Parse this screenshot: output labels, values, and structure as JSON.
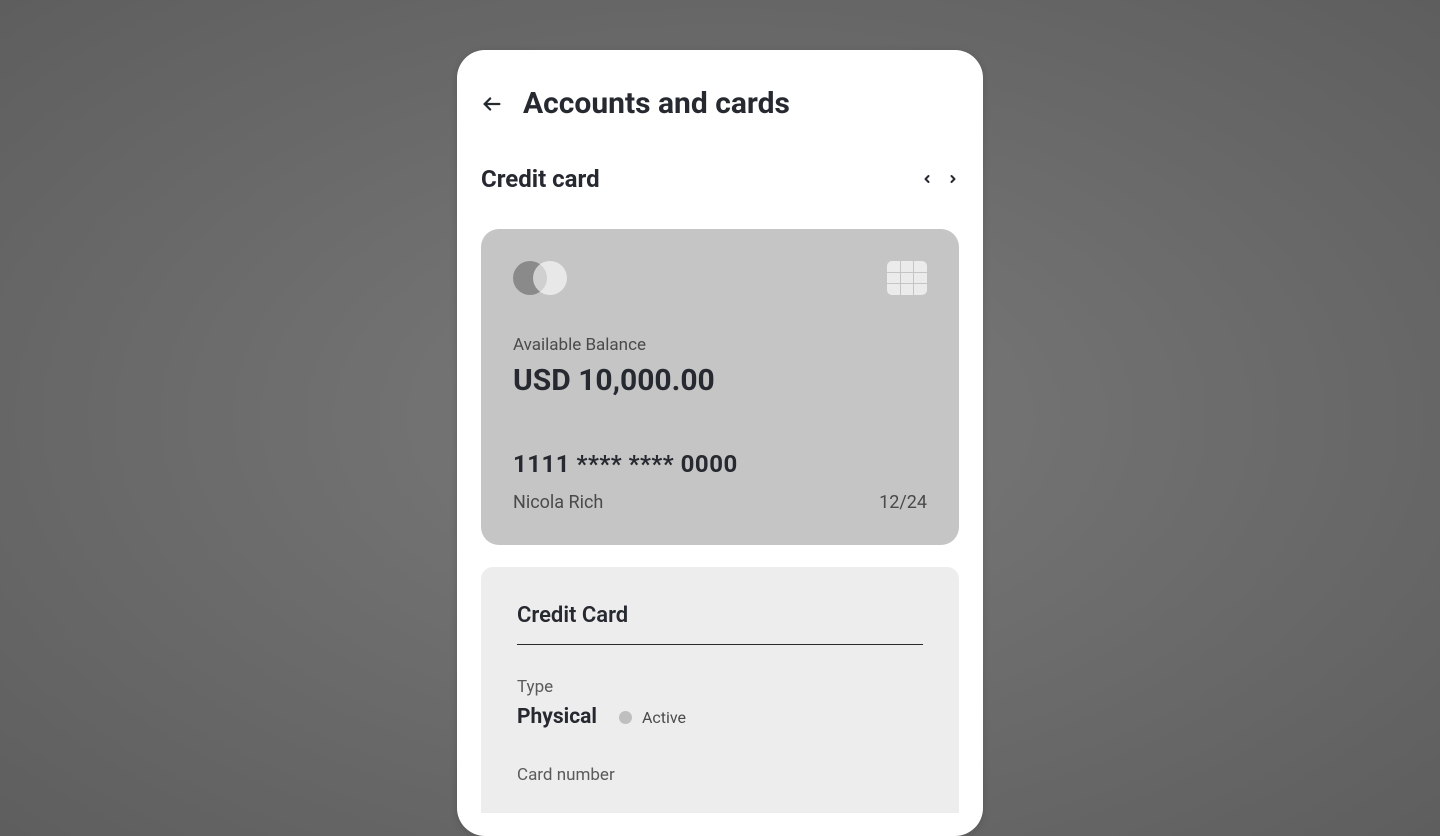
{
  "header": {
    "title": "Accounts and cards"
  },
  "section": {
    "title": "Credit card"
  },
  "card": {
    "balance_label": "Available Balance",
    "balance_value": "USD 10,000.00",
    "number": "1111 **** **** 0000",
    "holder": "Nicola Rich",
    "expiry": "12/24"
  },
  "details": {
    "title": "Credit Card",
    "type_label": "Type",
    "type_value": "Physical",
    "status": "Active",
    "card_number_label": "Card number"
  }
}
